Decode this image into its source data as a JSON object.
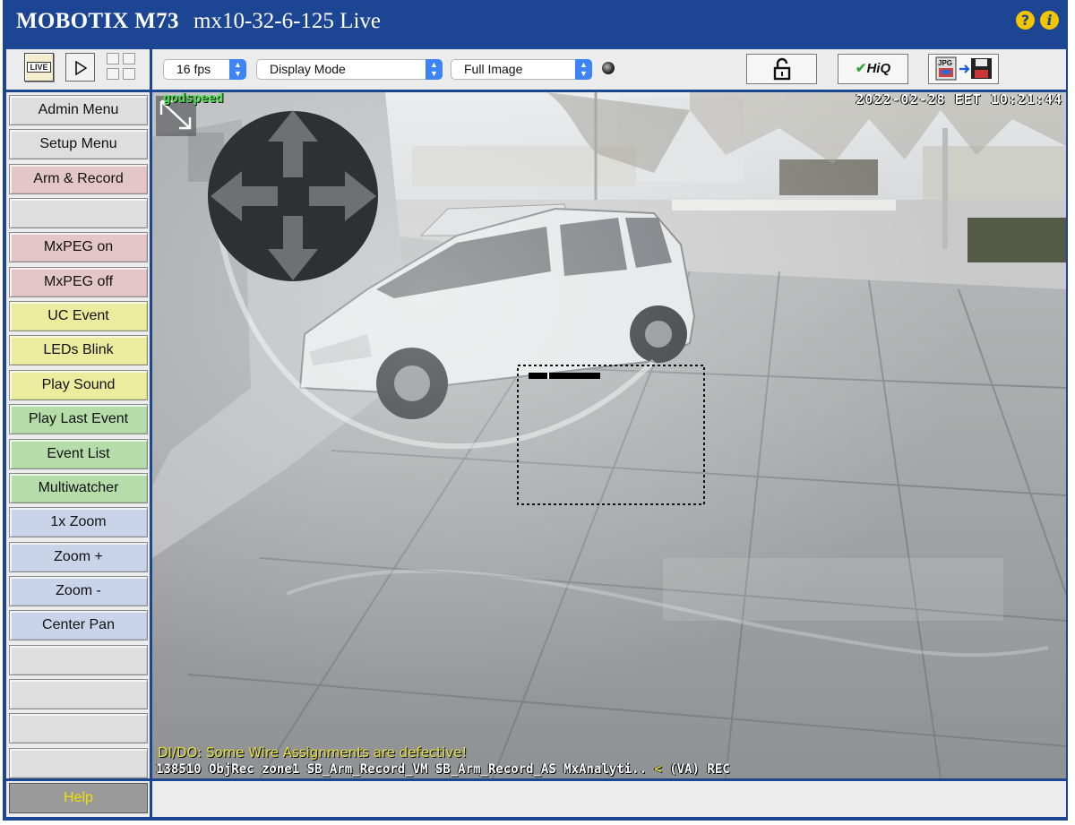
{
  "title_bar": {
    "brand": "MOBOTIX M73",
    "host": "mx10-32-6-125 Live",
    "help_icon": "question-icon",
    "info_icon": "info-icon"
  },
  "toolbar": {
    "live_label": "LIVE",
    "fps": "16 fps",
    "display_mode": "Display Mode",
    "image_mode": "Full Image",
    "hiq_label": "HiQ",
    "jpg_label": "JPG"
  },
  "sidebar": {
    "items": [
      {
        "label": "Admin Menu",
        "color": "gray"
      },
      {
        "label": "Setup Menu",
        "color": "gray"
      },
      {
        "label": "Arm & Record",
        "color": "red"
      },
      {
        "label": "",
        "color": "gray"
      },
      {
        "label": "MxPEG on",
        "color": "red"
      },
      {
        "label": "MxPEG off",
        "color": "red"
      },
      {
        "label": "UC Event",
        "color": "yellow"
      },
      {
        "label": "LEDs Blink",
        "color": "yellow"
      },
      {
        "label": "Play Sound",
        "color": "yellow"
      },
      {
        "label": "Play Last Event",
        "color": "green"
      },
      {
        "label": "Event List",
        "color": "green"
      },
      {
        "label": "Multiwatcher",
        "color": "green"
      },
      {
        "label": "1x Zoom",
        "color": "blue"
      },
      {
        "label": "Zoom +",
        "color": "blue"
      },
      {
        "label": "Zoom -",
        "color": "blue"
      },
      {
        "label": "Center Pan",
        "color": "blue"
      },
      {
        "label": "",
        "color": "gray"
      },
      {
        "label": "",
        "color": "gray"
      },
      {
        "label": "",
        "color": "gray"
      },
      {
        "label": "",
        "color": "gray"
      }
    ],
    "help_label": "Help"
  },
  "video": {
    "osd_top_left": "godspeed",
    "osd_top_right": "2022-02-28 EET 10:21:44",
    "osd_warning": "DI/DO: Some Wire Assignments are defective!",
    "osd_status": "138510 ObjRec zone1 SB_Arm_Record_VM SB_Arm_Record_AS MxAnalyti..",
    "osd_status_arrow": "<",
    "osd_status_end": "(VA) REC"
  },
  "colors": {
    "frame": "#1c4693",
    "help_text": "#f0e000"
  }
}
